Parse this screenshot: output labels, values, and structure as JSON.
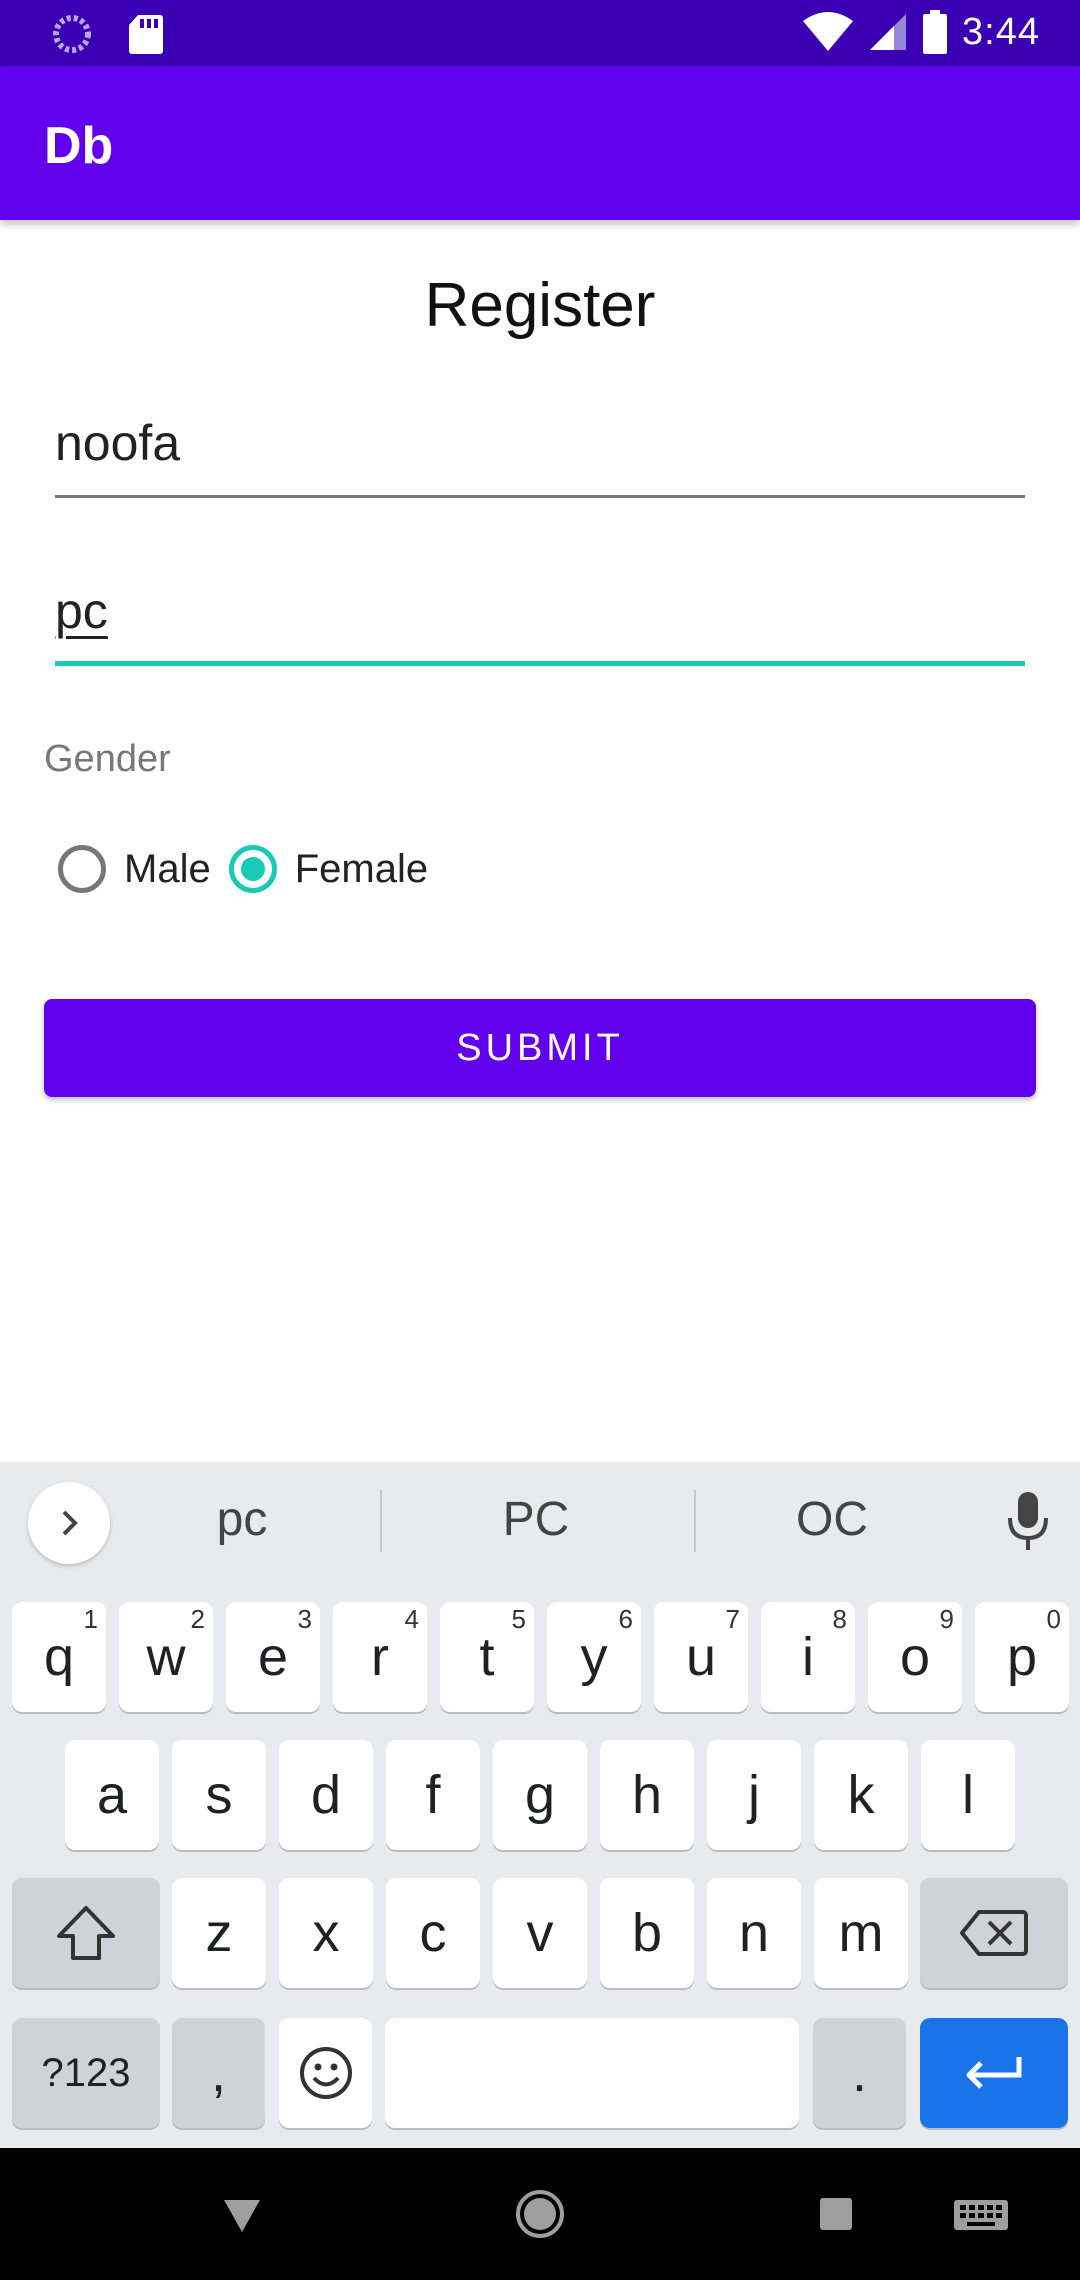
{
  "status_bar": {
    "time": "3:44",
    "icons": [
      "loading-icon",
      "sd-card-icon",
      "wifi-icon",
      "cell-signal-icon",
      "battery-icon"
    ]
  },
  "app_bar": {
    "title": "Db"
  },
  "form": {
    "heading": "Register",
    "name_value": "noofa",
    "second_value": "pc",
    "gender_label": "Gender",
    "options": [
      {
        "label": "Male",
        "checked": false
      },
      {
        "label": "Female",
        "checked": true
      }
    ],
    "submit_label": "SUBMIT"
  },
  "keyboard": {
    "suggestions": [
      "pc",
      "PC",
      "OC"
    ],
    "row1": [
      {
        "k": "q",
        "h": "1"
      },
      {
        "k": "w",
        "h": "2"
      },
      {
        "k": "e",
        "h": "3"
      },
      {
        "k": "r",
        "h": "4"
      },
      {
        "k": "t",
        "h": "5"
      },
      {
        "k": "y",
        "h": "6"
      },
      {
        "k": "u",
        "h": "7"
      },
      {
        "k": "i",
        "h": "8"
      },
      {
        "k": "o",
        "h": "9"
      },
      {
        "k": "p",
        "h": "0"
      }
    ],
    "row2": [
      "a",
      "s",
      "d",
      "f",
      "g",
      "h",
      "j",
      "k",
      "l"
    ],
    "row3": [
      "z",
      "x",
      "c",
      "v",
      "b",
      "n",
      "m"
    ],
    "symbols_label": "?123",
    "comma": ",",
    "period": "."
  },
  "colors": {
    "status_bar": "#3b00b3",
    "primary": "#6200ee",
    "accent": "#18c9b5",
    "enter": "#1a73e8"
  }
}
